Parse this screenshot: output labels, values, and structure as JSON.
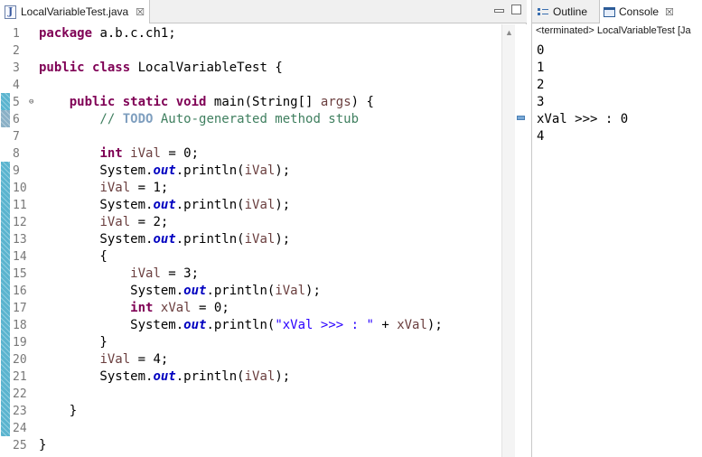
{
  "editor": {
    "tab_label": "LocalVariableTest.java",
    "tab_close": "☒",
    "line_numbers": [
      "1",
      "2",
      "3",
      "4",
      "5",
      "6",
      "7",
      "8",
      "9",
      "10",
      "11",
      "12",
      "13",
      "14",
      "15",
      "16",
      "17",
      "18",
      "19",
      "20",
      "21",
      "22",
      "23",
      "24",
      "25"
    ],
    "code": {
      "l1": [
        "package",
        " a.b.c.ch1;"
      ],
      "l3": [
        "public",
        " ",
        "class",
        " LocalVariableTest {"
      ],
      "l5": [
        "    ",
        "public",
        " ",
        "static",
        " ",
        "void",
        " main(String[] ",
        "args",
        ") {"
      ],
      "l6": [
        "        // ",
        "TODO",
        " Auto-generated method stub"
      ],
      "l8": [
        "        ",
        "int",
        " ",
        "iVal",
        " = 0;"
      ],
      "l9": [
        "        System.",
        "out",
        ".println(",
        "iVal",
        ");"
      ],
      "l10": [
        "        ",
        "iVal",
        " = 1;"
      ],
      "l11": [
        "        System.",
        "out",
        ".println(",
        "iVal",
        ");"
      ],
      "l12": [
        "        ",
        "iVal",
        " = 2;"
      ],
      "l13": [
        "        System.",
        "out",
        ".println(",
        "iVal",
        ");"
      ],
      "l14": [
        "        {"
      ],
      "l15": [
        "            ",
        "iVal",
        " = 3;"
      ],
      "l16": [
        "            System.",
        "out",
        ".println(",
        "iVal",
        ");"
      ],
      "l17": [
        "            ",
        "int",
        " ",
        "xVal",
        " = 0;"
      ],
      "l18": [
        "            System.",
        "out",
        ".println(",
        "\"xVal >>> : \"",
        " + ",
        "xVal",
        ");"
      ],
      "l19": [
        "        }"
      ],
      "l20": [
        "        ",
        "iVal",
        " = 4;"
      ],
      "l21": [
        "        System.",
        "out",
        ".println(",
        "iVal",
        ");"
      ],
      "l23": [
        "    }"
      ],
      "l25": [
        "}"
      ]
    }
  },
  "right": {
    "outline_label": "Outline",
    "console_label": "Console",
    "console_close": "☒",
    "terminated_text": "<terminated> LocalVariableTest [Ja",
    "output": [
      "0",
      "1",
      "2",
      "3",
      "xVal >>> : 0",
      "4"
    ]
  },
  "colors": {
    "keyword": "#7f0055",
    "comment": "#3f7f5f",
    "field": "#0000c0",
    "string": "#2a00ff",
    "change_bar": "#5ab4cf"
  }
}
